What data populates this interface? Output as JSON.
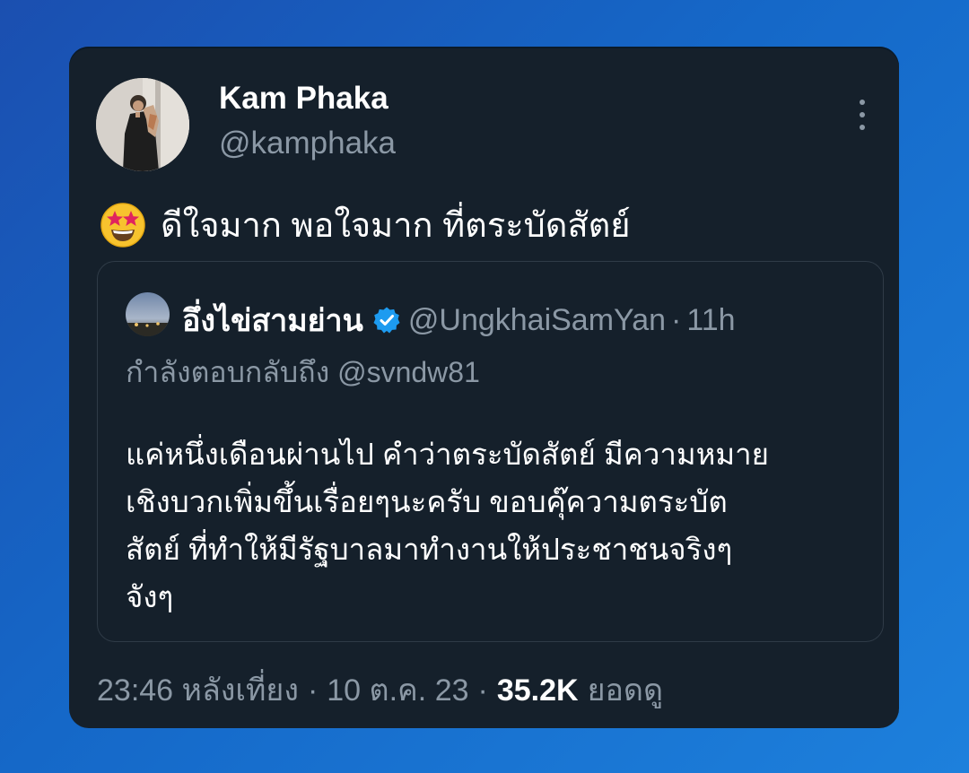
{
  "tweet": {
    "author": {
      "display_name": "Kam Phaka",
      "handle": "@kamphaka",
      "avatar_icon": "profile-photo"
    },
    "more_icon": "more-vertical-icon",
    "emoji_icon": "star-struck-emoji",
    "text": "ดีใจมาก พอใจมาก ที่ตระบัดสัตย์",
    "quoted": {
      "display_name": "อึ่งไข่สามย่าน",
      "verified_icon": "verified-badge-icon",
      "handle": "@UngkhaiSamYan",
      "separator": "·",
      "time": "11h",
      "reply_to": "กำลังตอบกลับถึง @svndw81",
      "body_lines": [
        "แค่หนึ่งเดือนผ่านไป คำว่าตระบัดสัตย์ มีความหมาย",
        "เชิงบวกเพิ่มขึ้นเรื่อยๆนะครับ ขอบคุ๊ความตระบัต",
        "สัตย์  ที่ทำให้มีรัฐบาลมาทำงานให้ประชาชนจริงๆ",
        "จังๆ"
      ]
    },
    "meta": {
      "time": "23:46 หลังเที่ยง",
      "date": "10 ต.ค. 23",
      "separator": "·",
      "views_count": "35.2K",
      "views_label": "ยอดดู"
    }
  },
  "colors": {
    "card_background": "#15202b",
    "secondary_text": "#8b98a5",
    "primary_text": "#ffffff",
    "verified_blue": "#1d9bf0",
    "quote_border": "#2f3b47"
  }
}
